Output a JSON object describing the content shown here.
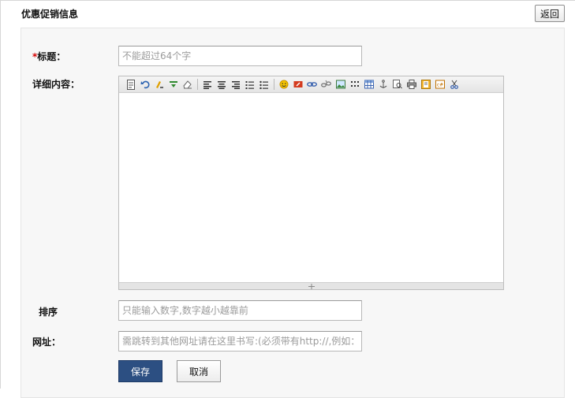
{
  "header": {
    "title": "优惠促销信息",
    "back_label": "返回"
  },
  "form": {
    "title_required_mark": "*",
    "title_label": "标题：",
    "title_placeholder": "不能超过64个字",
    "content_label": "详细内容：",
    "sort_label": "排序",
    "sort_placeholder": "只能输入数字,数字越小越靠前",
    "url_label": "网址：",
    "url_placeholder": "需跳转到其他网址请在这里书写:(必须带有http://,例如：",
    "save_label": "保存",
    "cancel_label": "取消"
  },
  "editor": {
    "toolbar": [
      "source-icon",
      "undo-icon",
      "clear-format-icon",
      "paste-text-icon",
      "eraser-icon",
      "sep",
      "align-left-icon",
      "align-center-icon",
      "align-right-icon",
      "ordered-list-icon",
      "unordered-list-icon",
      "sep",
      "emoticon-icon",
      "flash-icon",
      "link-icon",
      "unlink-icon",
      "image-icon",
      "special-char-icon",
      "table-icon",
      "anchor-icon",
      "preview-icon",
      "print-icon",
      "insert-file-icon",
      "insert-code-icon",
      "cut-icon"
    ],
    "colors": {
      "toolbar_bg": "#e9e9e9",
      "border": "#bdbdbd"
    }
  },
  "colors": {
    "accent": "#2c4f82",
    "required": "#d40000"
  }
}
